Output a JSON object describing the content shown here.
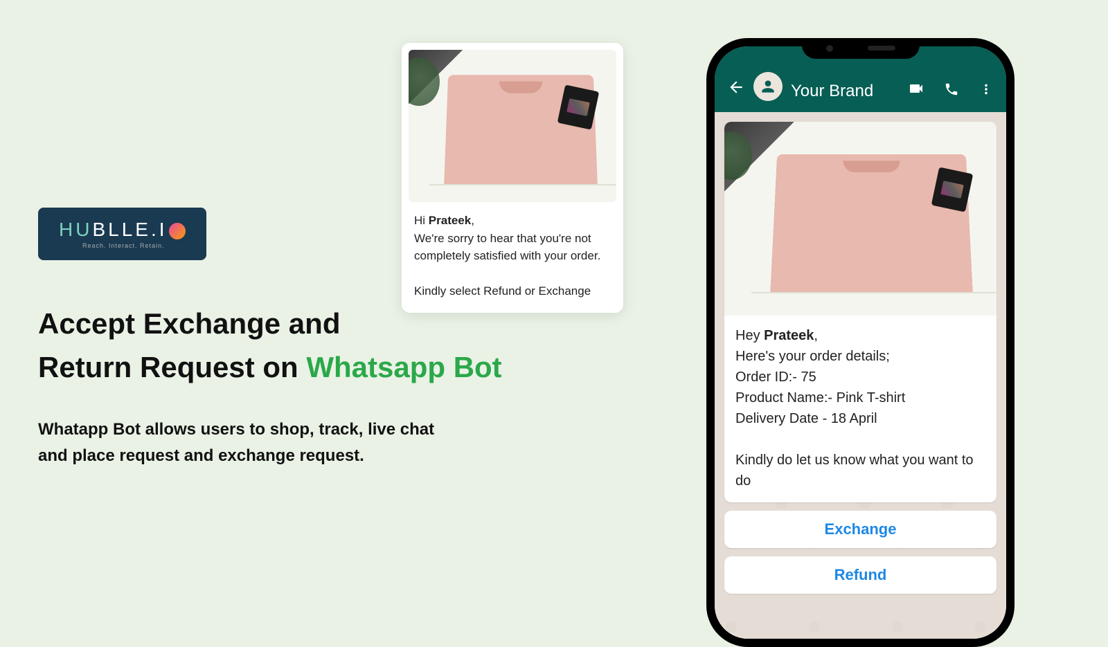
{
  "logo": {
    "text_part1": "HU",
    "text_part2": "BLLE",
    "text_part3": ".I",
    "tagline": "Reach. Interact. Retain."
  },
  "headline": {
    "line1": "Accept Exchange and",
    "line2a": "Return Request on ",
    "line2b": "Whatsapp Bot"
  },
  "subtext": {
    "line1": "Whatapp Bot allows users to shop, track, live chat",
    "line2": "and place request and exchange request."
  },
  "floating_card": {
    "greeting_prefix": "Hi ",
    "greeting_name": "Prateek",
    "greeting_suffix": ",",
    "line1": "We're sorry to hear that you're not completely satisfied with your order.",
    "line2": "Kindly select Refund or Exchange"
  },
  "phone": {
    "brand": "Your Brand",
    "message": {
      "greeting_prefix": "Hey ",
      "greeting_name": "Prateek",
      "greeting_suffix": ",",
      "intro": "Here's your order details;",
      "order_id": "Order ID:- 75",
      "product": "Product Name:- Pink T-shirt",
      "delivery": "Delivery Date - 18 April",
      "prompt": "Kindly do let us know what you want to do"
    },
    "buttons": {
      "exchange": "Exchange",
      "refund": "Refund"
    }
  }
}
